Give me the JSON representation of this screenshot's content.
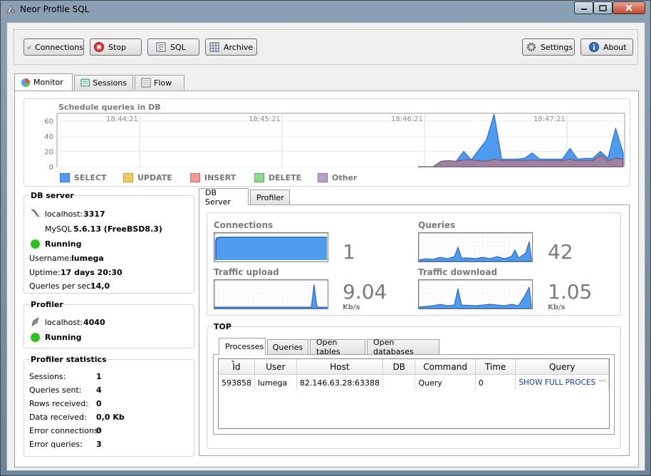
{
  "window": {
    "title": "Neor Profile SQL"
  },
  "toolbar": {
    "connections": "Connections",
    "stop": "Stop",
    "sql": "SQL",
    "archive": "Archive",
    "settings": "Settings",
    "about": "About"
  },
  "main_tabs": [
    "Monitor",
    "Sessions",
    "Flow"
  ],
  "schedule": {
    "title": "Schedule queries in DB",
    "times": [
      "18:44:21",
      "18:45:21",
      "18:46:21",
      "18:47:21"
    ],
    "yticks": [
      "60",
      "40",
      "20",
      "0"
    ],
    "legend": [
      "SELECT",
      "UPDATE",
      "INSERT",
      "DELETE",
      "Other"
    ],
    "colors": {
      "select": "#4f9bef",
      "update": "#f5c85c",
      "insert": "#f19a9a",
      "delete": "#8fd88f",
      "other": "#b99fcc"
    }
  },
  "chart_data": {
    "type": "area",
    "title": "Schedule queries in DB",
    "ylim": [
      0,
      70
    ],
    "x_ticks": [
      "18:44:21",
      "18:45:21",
      "18:46:21",
      "18:47:21"
    ],
    "series": [
      {
        "name": "SELECT",
        "values": [
          0,
          0,
          0,
          7,
          8,
          7,
          20,
          9,
          22,
          35,
          69,
          10,
          10,
          10,
          11,
          18,
          10,
          10,
          10,
          10,
          24,
          10,
          11,
          11,
          20,
          11,
          50,
          18
        ]
      },
      {
        "name": "Other",
        "values": [
          0,
          0,
          0,
          7,
          8,
          7,
          9,
          9,
          8,
          7,
          10,
          8,
          8,
          8,
          8,
          9,
          8,
          8,
          8,
          8,
          10,
          8,
          8,
          8,
          15,
          8,
          11,
          10
        ]
      }
    ]
  },
  "db_server": {
    "title": "DB server",
    "host": "localhost:",
    "port": "3317",
    "engine": "MySQL",
    "version": "5.6.13 (FreeBSD8.3)",
    "status": "Running",
    "username_label": "Username:",
    "username": "lumega",
    "uptime_label": "Uptime:",
    "uptime": "17 days 20:30",
    "qps_label": "Queries per sec:",
    "qps": "14,0"
  },
  "profiler": {
    "title": "Profiler",
    "host": "localhost:",
    "port": "4040",
    "status": "Running"
  },
  "profiler_stats": {
    "title": "Profiler statistics",
    "rows": [
      {
        "label": "Sessions:",
        "value": "1"
      },
      {
        "label": "Queries sent:",
        "value": "4"
      },
      {
        "label": "Rows received:",
        "value": "0"
      },
      {
        "label": "Data received:",
        "value": "0,0 Kb"
      },
      {
        "label": "Error connections:",
        "value": "0"
      },
      {
        "label": "Error queries:",
        "value": "3"
      }
    ]
  },
  "right_tabs": [
    "DB Server",
    "Profiler"
  ],
  "metrics": {
    "connections": {
      "title": "Connections",
      "value": "1"
    },
    "queries": {
      "title": "Queries",
      "value": "42"
    },
    "upload": {
      "title": "Traffic upload",
      "value": "9.04",
      "unit": "Kb/s"
    },
    "download": {
      "title": "Traffic download",
      "value": "1.05",
      "unit": "Kb/s"
    }
  },
  "top": {
    "title": "TOP",
    "tabs": [
      "Processes",
      "Queries",
      "Open tables",
      "Open databases"
    ],
    "columns": [
      "Id",
      "User",
      "Host",
      "DB",
      "Command",
      "Time",
      "Query"
    ],
    "rows": [
      [
        "593858",
        "lumega",
        "82.146.63.28:63388",
        "",
        "Query",
        "0",
        "SHOW FULL PROCES"
      ]
    ],
    "more": "···"
  }
}
